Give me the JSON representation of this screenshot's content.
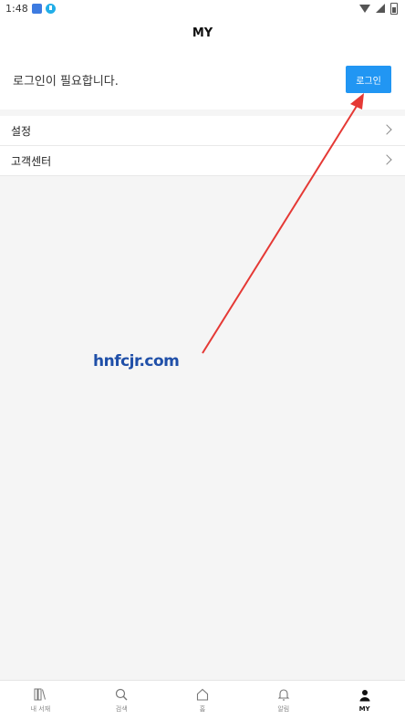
{
  "status_bar": {
    "time": "1:48"
  },
  "header": {
    "title": "MY"
  },
  "login": {
    "message": "로그인이 필요합니다.",
    "button_label": "로그인",
    "button_color": "#2196f3"
  },
  "menu": {
    "items": [
      {
        "label": "설정"
      },
      {
        "label": "고객센터"
      }
    ]
  },
  "watermark": {
    "text": "hnfcjr.com"
  },
  "bottom_nav": {
    "items": [
      {
        "label": "내 서재",
        "icon": "bookshelf-icon"
      },
      {
        "label": "검색",
        "icon": "search-icon"
      },
      {
        "label": "홈",
        "icon": "home-icon"
      },
      {
        "label": "알림",
        "icon": "bell-icon"
      },
      {
        "label": "MY",
        "icon": "person-icon",
        "active": true
      }
    ]
  },
  "colors": {
    "accent": "#2196f3",
    "background": "#f5f5f5",
    "annotation_arrow": "#e53935"
  }
}
